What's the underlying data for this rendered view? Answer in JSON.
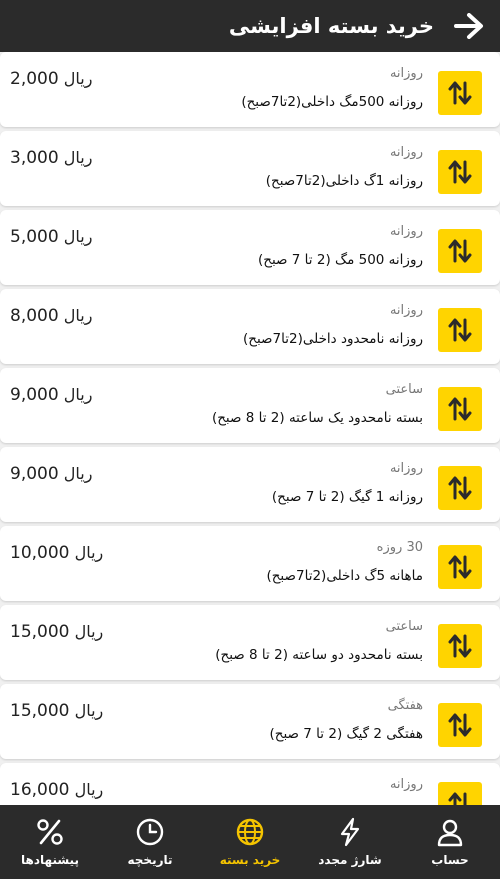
{
  "header": {
    "title": "خرید بسته افزایشی"
  },
  "packages": [
    {
      "type": "روزانه",
      "name": "روزانه 500مگ داخلی(2تا7صبح)",
      "price": "2,000",
      "currency": "ریال"
    },
    {
      "type": "روزانه",
      "name": "روزانه 1گ داخلی(2تا7صبح)",
      "price": "3,000",
      "currency": "ریال"
    },
    {
      "type": "روزانه",
      "name": "روزانه 500 مگ (2 تا 7 صبح)",
      "price": "5,000",
      "currency": "ریال"
    },
    {
      "type": "روزانه",
      "name": "روزانه نامحدود داخلی(2تا7صبح)",
      "price": "8,000",
      "currency": "ریال"
    },
    {
      "type": "ساعتی",
      "name": "بسته نامحدود یک ساعته (2 تا 8 صبح)",
      "price": "9,000",
      "currency": "ریال"
    },
    {
      "type": "روزانه",
      "name": "روزانه 1 گیگ (2 تا 7 صبح)",
      "price": "9,000",
      "currency": "ریال"
    },
    {
      "type": "30 روزه",
      "name": "ماهانه 5گ داخلی(2تا7صبح)",
      "price": "10,000",
      "currency": "ریال"
    },
    {
      "type": "ساعتی",
      "name": "بسته نامحدود دو ساعته (2 تا 8 صبح)",
      "price": "15,000",
      "currency": "ریال"
    },
    {
      "type": "هفتگی",
      "name": "هفتگی 2 گیگ (2 تا 7 صبح)",
      "price": "15,000",
      "currency": "ریال"
    },
    {
      "type": "روزانه",
      "name": "",
      "price": "16,000",
      "currency": "ریال"
    }
  ],
  "nav": {
    "account": "حساب",
    "recharge": "شارژ مجدد",
    "buy_package": "خرید بسته",
    "history": "تاریخچه",
    "offers": "پیشنهادها"
  },
  "colors": {
    "bar": "#2b2b2b",
    "accent": "#ffd400",
    "active_nav": "#f5c400"
  }
}
